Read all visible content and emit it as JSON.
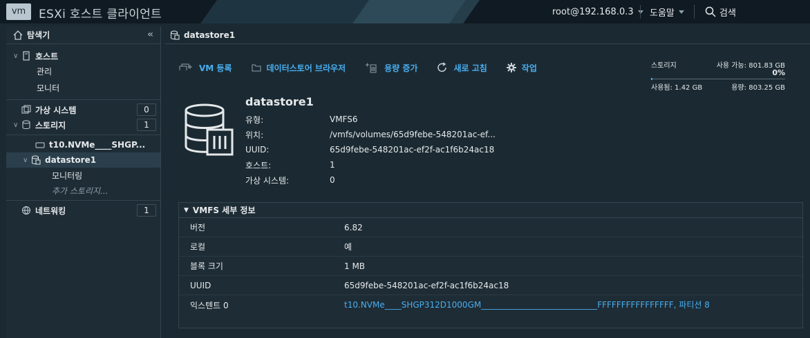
{
  "topbar": {
    "logo": "vm",
    "title": "ESXi 호스트 클라이언트",
    "user": "root@192.168.0.3",
    "help": "도움말",
    "search": "검색"
  },
  "sidebar": {
    "title": "탐색기",
    "host": "호스트",
    "manage": "관리",
    "monitor": "모니터",
    "vms": {
      "label": "가상 시스템",
      "count": "0"
    },
    "storage": {
      "label": "스토리지",
      "count": "1"
    },
    "device": "t10.NVMe____SHGP...",
    "datastore": "datastore1",
    "ds_monitor": "모니터링",
    "more_storage": "추가 스토리지...",
    "networking": {
      "label": "네트워킹",
      "count": "1"
    }
  },
  "main": {
    "header": "datastore1",
    "toolbar": {
      "register_vm": "VM 등록",
      "browser": "데이터스토어 브라우저",
      "increase": "용량 증가",
      "refresh": "새로 고침",
      "actions": "작업"
    },
    "summary": {
      "storage_label": "스토리지",
      "free": "사용 가능: 801.83 GB",
      "percent": "0%",
      "used": "사용됨: 1.42 GB",
      "capacity": "용량: 803.25 GB"
    },
    "info": {
      "name": "datastore1",
      "rows": [
        {
          "k": "유형:",
          "v": "VMFS6"
        },
        {
          "k": "위치:",
          "v": "/vmfs/volumes/65d9febe-548201ac-ef..."
        },
        {
          "k": "UUID:",
          "v": "65d9febe-548201ac-ef2f-ac1f6b24ac18"
        },
        {
          "k": "호스트:",
          "v": "1"
        },
        {
          "k": "가상 시스템:",
          "v": "0"
        }
      ]
    },
    "vmfs": {
      "title": "VMFS 세부 정보",
      "rows": [
        {
          "k": "버전",
          "v": "6.82"
        },
        {
          "k": "로컬",
          "v": "예"
        },
        {
          "k": "블록 크기",
          "v": "1 MB"
        },
        {
          "k": "UUID",
          "v": "65d9febe-548201ac-ef2f-ac1f6b24ac18"
        },
        {
          "k": "익스텐트 0",
          "v": "t10.NVMe____SHGP312D1000GM____________________________FFFFFFFFFFFFFFFF, 파티션 8"
        }
      ]
    },
    "colors": {
      "accent": "#49aef0",
      "bg": "#1b2a32"
    }
  }
}
